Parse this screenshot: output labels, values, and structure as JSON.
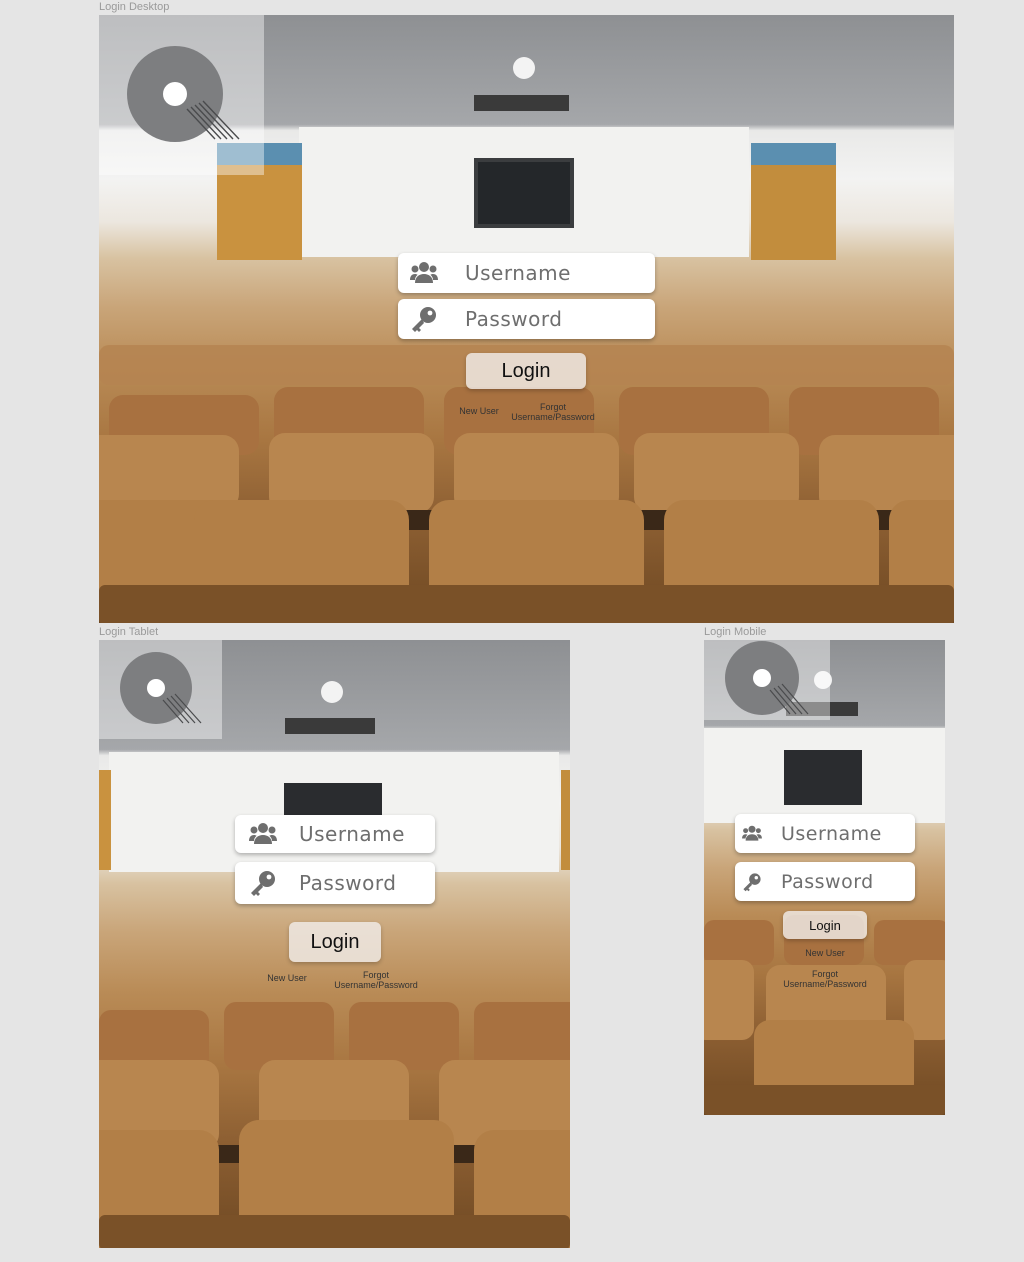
{
  "frames": {
    "desktop": {
      "label": "Login Desktop"
    },
    "tablet": {
      "label": "Login Tablet"
    },
    "mobile": {
      "label": "Login Mobile"
    }
  },
  "login_form": {
    "username_placeholder": "Username",
    "password_placeholder": "Password",
    "login_label": "Login",
    "new_user_label": "New User",
    "forgot_line1": "Forgot",
    "forgot_line2": "Username/Password"
  },
  "icons": {
    "logo": "q-logo-icon",
    "username": "users-icon",
    "password": "key-icon"
  },
  "colors": {
    "canvas": "#e5e5e5",
    "field_text": "#6e6e6e",
    "seat_wood": "#b98b56"
  }
}
